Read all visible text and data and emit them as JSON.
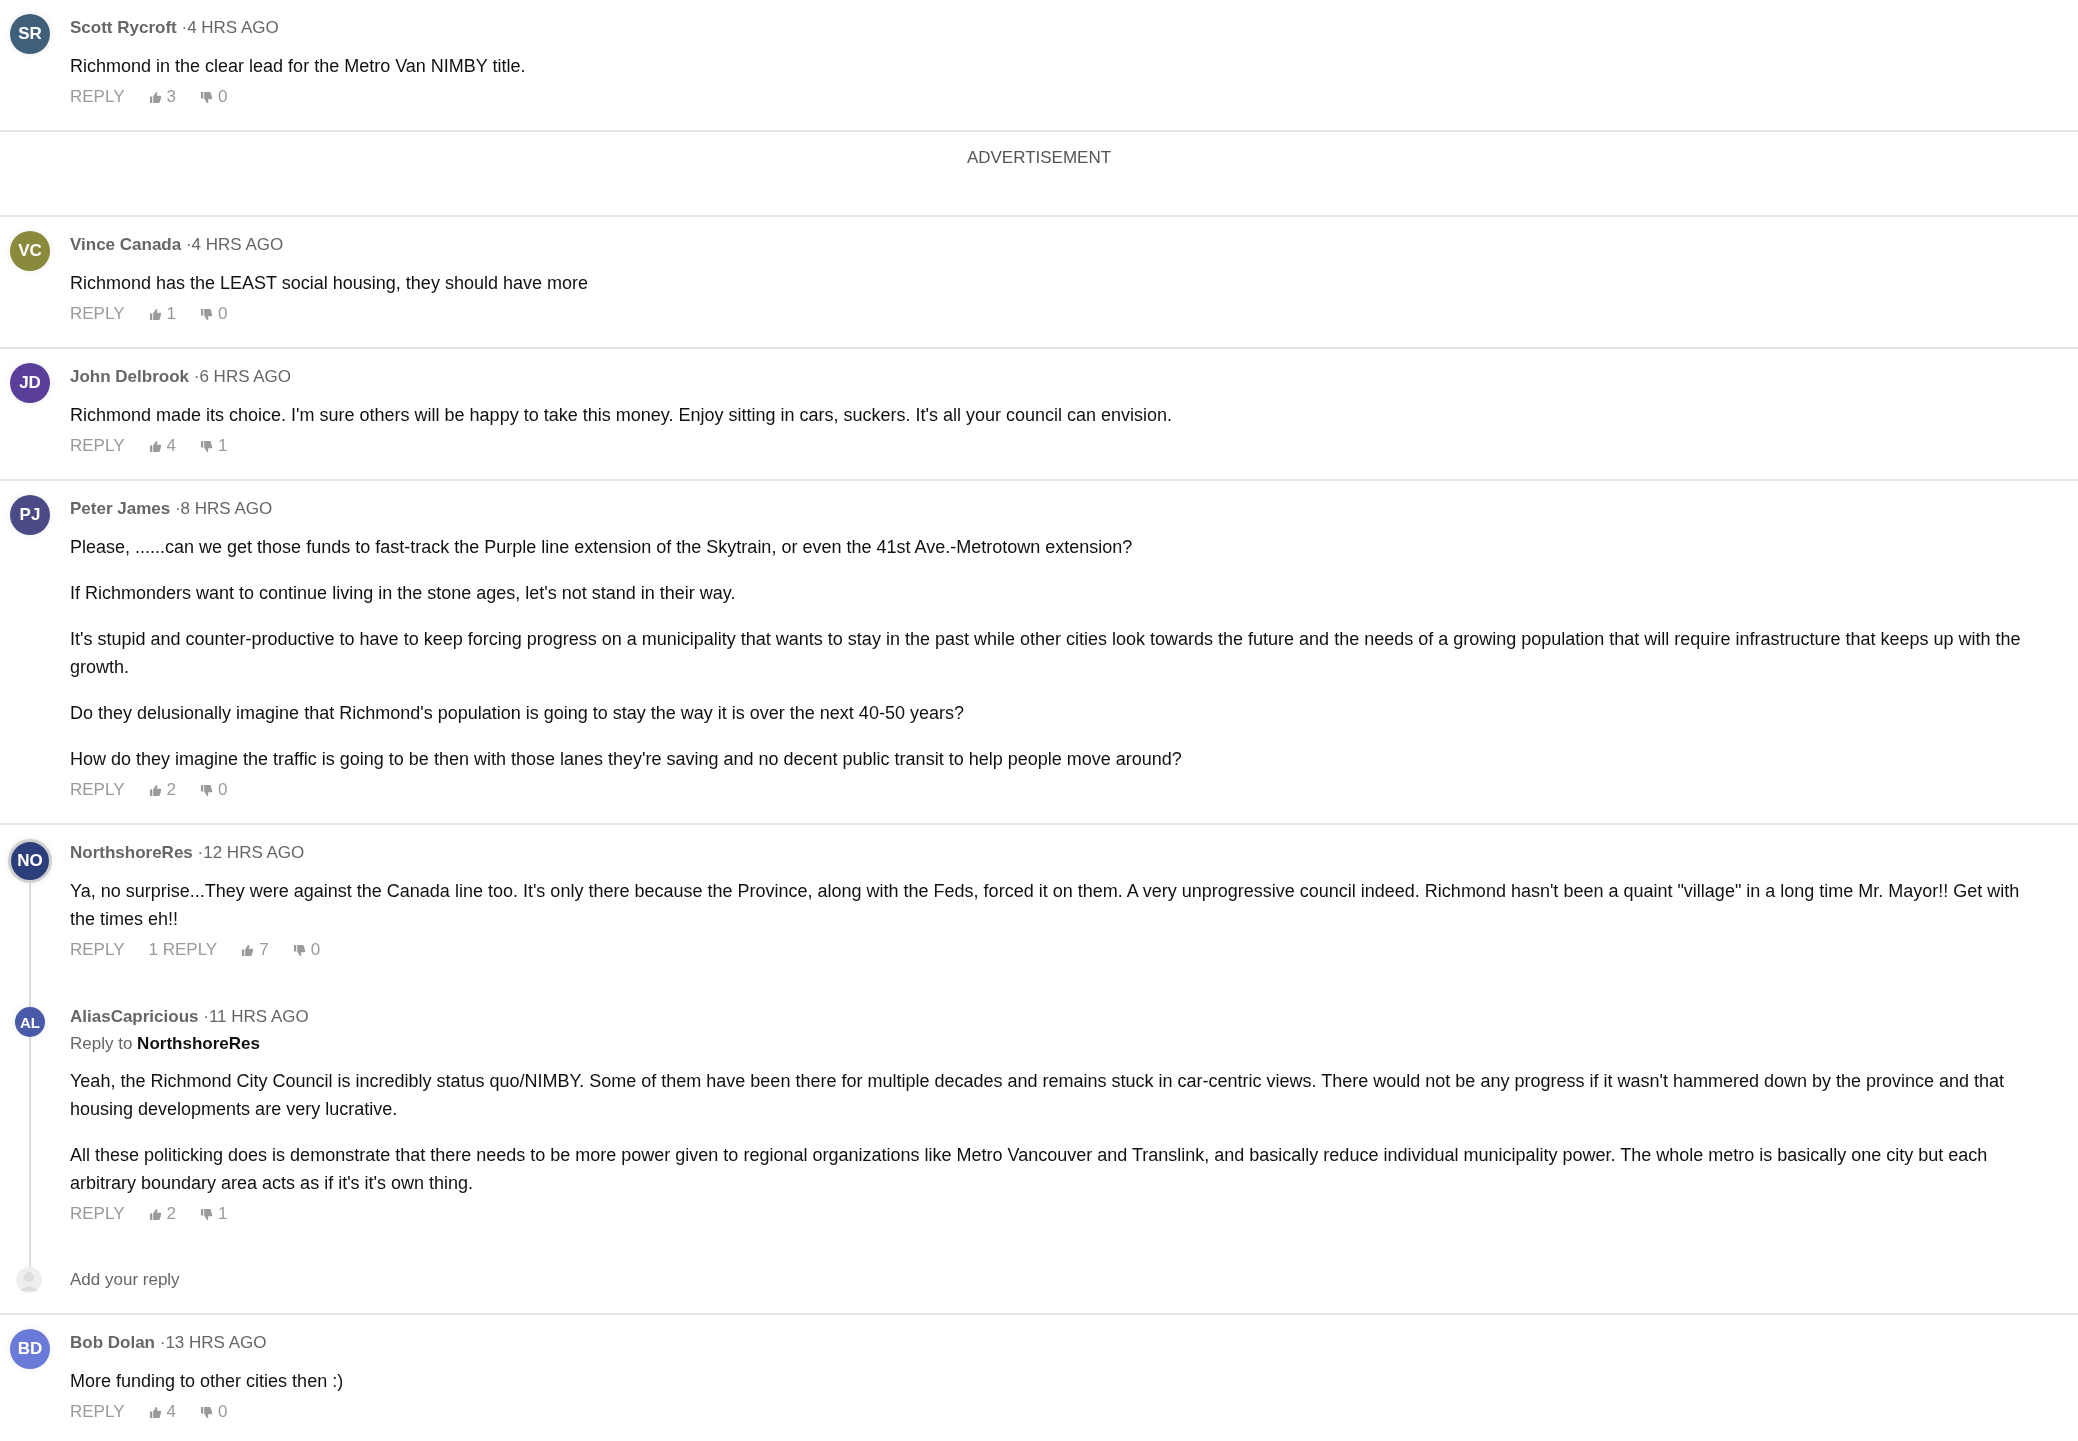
{
  "separator": "·",
  "items": [
    {
      "kind": "comment",
      "initials": "SR",
      "color": "#3f5f7a",
      "author": "Scott Rycroft",
      "time": "4 HRS AGO",
      "paragraphs": [
        "Richmond in the clear lead for the Metro Van NIMBY title."
      ],
      "reply": "REPLY",
      "likes": "3",
      "dislikes": "0"
    },
    {
      "kind": "advertisement",
      "label": "ADVERTISEMENT"
    },
    {
      "kind": "comment",
      "initials": "VC",
      "color": "#8a8a3c",
      "author": "Vince Canada",
      "time": "4 HRS AGO",
      "paragraphs": [
        "Richmond has the LEAST social housing, they should have more"
      ],
      "reply": "REPLY",
      "likes": "1",
      "dislikes": "0"
    },
    {
      "kind": "comment",
      "initials": "JD",
      "color": "#5a3f9a",
      "author": "John Delbrook",
      "time": "6 HRS AGO",
      "paragraphs": [
        "Richmond made its choice. I'm sure others will be happy to take this money. Enjoy sitting in cars, suckers. It's all your council can envision."
      ],
      "reply": "REPLY",
      "likes": "4",
      "dislikes": "1"
    },
    {
      "kind": "comment",
      "initials": "PJ",
      "color": "#4a4a86",
      "author": "Peter James",
      "time": "8 HRS AGO",
      "paragraphs": [
        "Please, ......can we get those funds to fast-track the Purple line extension of the Skytrain, or even the 41st Ave.-Metrotown extension?",
        "If Richmonders want to continue living in the stone ages, let's not stand in their way.",
        "It's stupid and counter-productive to have to keep forcing progress on a municipality that wants to stay in the past while other cities look towards the future and the needs of a growing population that will require infrastructure that keeps up with the growth.",
        "Do they delusionally imagine that Richmond's population is going to stay the way it is over the next 40-50 years?",
        "How do they imagine the traffic is going to be then with those lanes they're saving and no decent public transit to help people move around?"
      ],
      "reply": "REPLY",
      "likes": "2",
      "dislikes": "0"
    },
    {
      "kind": "comment",
      "initials": "NO",
      "color": "#2c3f7a",
      "author": "NorthshoreRes",
      "time": "12 HRS AGO",
      "paragraphs": [
        "Ya, no surprise...They were against the Canada line too. It's only there because the Province, along with the Feds, forced it on them. A very unprogressive council indeed. Richmond hasn't been a quaint \"village\" in a long time Mr. Mayor!! Get with the times eh!!"
      ],
      "reply": "REPLY",
      "reply_count": "1 REPLY",
      "likes": "7",
      "dislikes": "0",
      "children": [
        {
          "initials": "AL",
          "color": "#4a5aa8",
          "author": "AliasCapricious",
          "time": "11 HRS AGO",
          "reply_prefix": "Reply to",
          "reply_to": "NorthshoreRes",
          "paragraphs": [
            "Yeah, the Richmond City Council is incredibly status quo/NIMBY. Some of them have been there for multiple decades and remains stuck in car-centric views. There would not be any progress if it wasn't hammered down by the province and that housing developments are very lucrative.",
            "All these politicking does is demonstrate that there needs to be more power given to regional organizations like Metro Vancouver and Translink, and basically reduce individual municipality power. The whole metro is basically one city but each arbitrary boundary area acts as if it's it's own thing."
          ],
          "reply": "REPLY",
          "likes": "2",
          "dislikes": "1"
        }
      ],
      "add_reply": {
        "placeholder": "Add your reply"
      }
    },
    {
      "kind": "comment",
      "initials": "BD",
      "color": "#6a7ad8",
      "author": "Bob Dolan",
      "time": "13 HRS AGO",
      "paragraphs": [
        "More funding to other cities then :)"
      ],
      "reply": "REPLY",
      "likes": "4",
      "dislikes": "0"
    }
  ]
}
